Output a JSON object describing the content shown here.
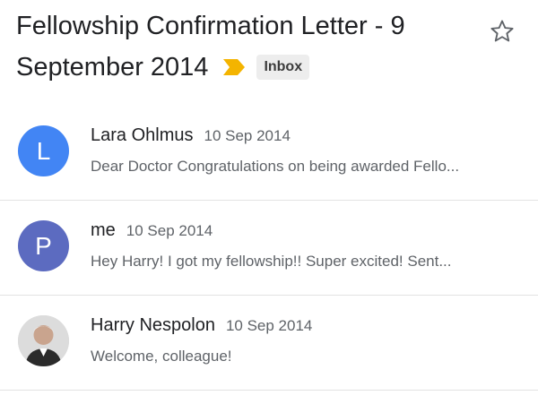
{
  "header": {
    "subject_line1": "Fellowship Confirmation Letter - 9",
    "subject_line2": "September 2014",
    "label": "Inbox",
    "importance_icon": "importance-marker-icon",
    "star_icon": "star-outline-icon",
    "colors": {
      "importance": "#f4b400",
      "star": "#5f6368"
    }
  },
  "messages": [
    {
      "avatar_letter": "L",
      "avatar_color": "#4285f4",
      "sender": "Lara Ohlmus",
      "date": "10 Sep 2014",
      "snippet": "Dear Doctor Congratulations on being awarded Fello..."
    },
    {
      "avatar_letter": "P",
      "avatar_color": "#5c6bc0",
      "sender": "me",
      "date": "10 Sep 2014",
      "snippet": "Hey Harry! I got my fellowship!! Super excited! Sent..."
    },
    {
      "avatar_letter": "",
      "avatar_color": "#d9d9d9",
      "sender": "Harry Nespolon",
      "date": "10 Sep 2014",
      "snippet": "Welcome, colleague!"
    }
  ]
}
